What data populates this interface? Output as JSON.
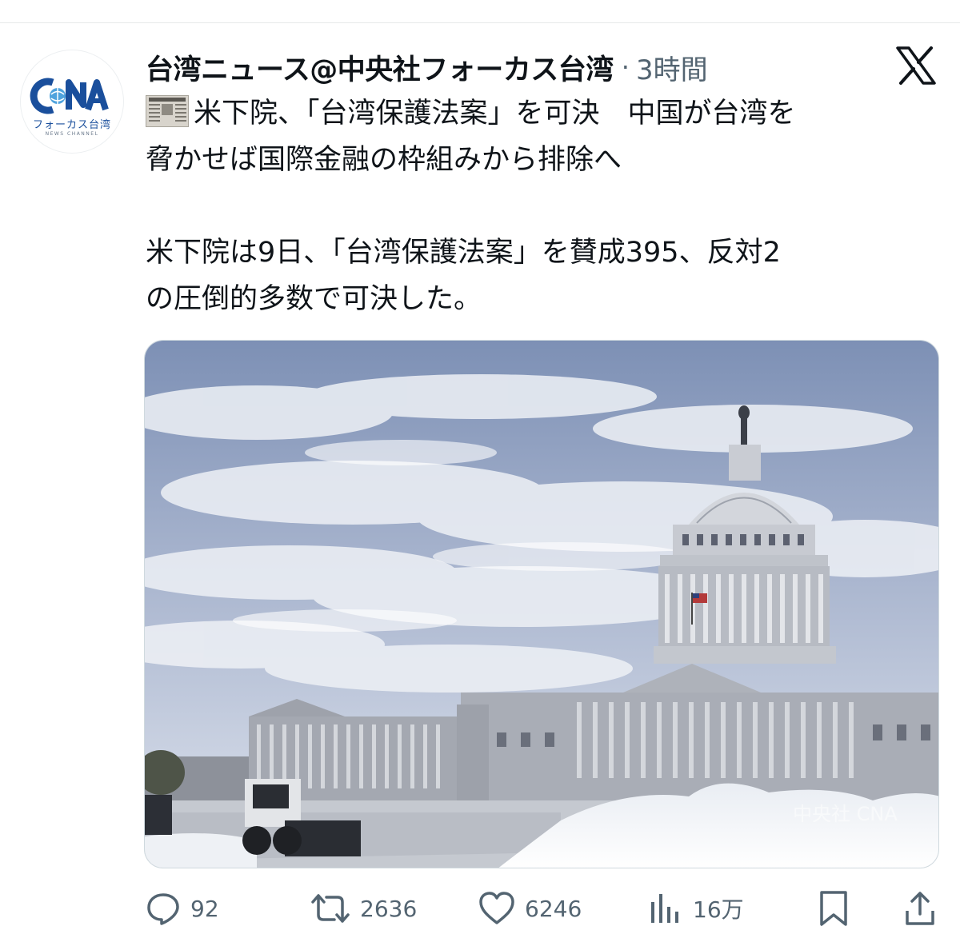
{
  "tweet": {
    "display_name": "台湾ニュース@中央社フォーカス台湾",
    "separator": "·",
    "time_ago": "3時間",
    "avatar": {
      "logo_text": "CNA",
      "caption": "フォーカス台湾",
      "subcaption": "NEWS CHANNEL"
    },
    "platform_icon": "x-logo-icon",
    "text_line_1": "米下院、「台湾保護法案」を可決　中国が台湾を",
    "text_line_2": "脅かせば国際金融の枠組みから排除へ",
    "text_line_3": "米下院は9日、「台湾保護法案」を賛成395、反対2",
    "text_line_4": "の圧倒的多数で可決した。",
    "leading_emoji": "newspaper-emoji",
    "media": {
      "kind": "photo",
      "watermark": "中央社 CNA",
      "subject": "capitol-building-in-snow"
    }
  },
  "actions": {
    "reply": {
      "icon": "reply-icon",
      "count": "92"
    },
    "repost": {
      "icon": "repost-icon",
      "count": "2636"
    },
    "like": {
      "icon": "heart-icon",
      "count": "6246"
    },
    "views": {
      "icon": "views-icon",
      "count": "16万"
    },
    "bookmark": {
      "icon": "bookmark-icon"
    },
    "share": {
      "icon": "share-icon"
    }
  },
  "colors": {
    "text_primary": "#0f1419",
    "text_secondary": "#536471",
    "divider": "#e7e9ea",
    "cna_blue": "#1a4f9c"
  }
}
